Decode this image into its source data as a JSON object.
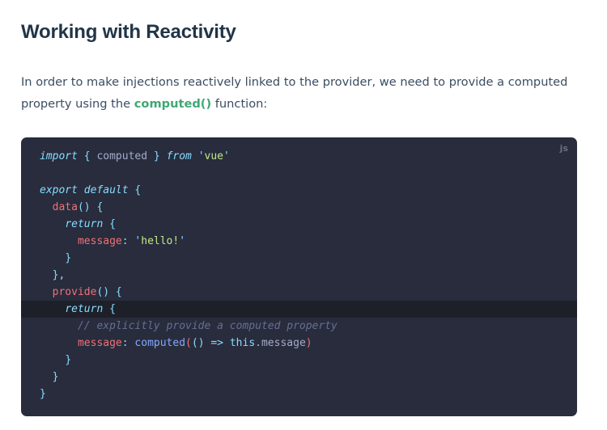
{
  "heading": "Working with Reactivity",
  "paragraph": {
    "before": "In order to make injections reactively linked to the provider, we need to provide a computed property using the ",
    "code_link": "computed()",
    "after": " function:"
  },
  "code_block": {
    "language": "js",
    "highlighted_line_index": 10,
    "lines": [
      {
        "tokens": [
          {
            "t": "kw",
            "v": "import"
          },
          {
            "t": "punc",
            "v": " { "
          },
          {
            "t": "ident",
            "v": "computed"
          },
          {
            "t": "punc",
            "v": " } "
          },
          {
            "t": "kw",
            "v": "from"
          },
          {
            "t": "plain",
            "v": " "
          },
          {
            "t": "punc",
            "v": "'"
          },
          {
            "t": "str",
            "v": "vue"
          },
          {
            "t": "punc",
            "v": "'"
          }
        ]
      },
      {
        "tokens": []
      },
      {
        "tokens": [
          {
            "t": "kw",
            "v": "export"
          },
          {
            "t": "plain",
            "v": " "
          },
          {
            "t": "kw",
            "v": "default"
          },
          {
            "t": "punc",
            "v": " {"
          }
        ]
      },
      {
        "tokens": [
          {
            "t": "plain",
            "v": "  "
          },
          {
            "t": "fn",
            "v": "data"
          },
          {
            "t": "punc",
            "v": "() {"
          }
        ]
      },
      {
        "tokens": [
          {
            "t": "plain",
            "v": "    "
          },
          {
            "t": "kw",
            "v": "return"
          },
          {
            "t": "punc",
            "v": " {"
          }
        ]
      },
      {
        "tokens": [
          {
            "t": "plain",
            "v": "      "
          },
          {
            "t": "prop",
            "v": "message"
          },
          {
            "t": "punc",
            "v": ": "
          },
          {
            "t": "punc",
            "v": "'"
          },
          {
            "t": "str",
            "v": "hello!"
          },
          {
            "t": "punc",
            "v": "'"
          }
        ]
      },
      {
        "tokens": [
          {
            "t": "plain",
            "v": "    "
          },
          {
            "t": "punc",
            "v": "}"
          }
        ]
      },
      {
        "tokens": [
          {
            "t": "plain",
            "v": "  "
          },
          {
            "t": "punc",
            "v": "},"
          }
        ]
      },
      {
        "tokens": [
          {
            "t": "plain",
            "v": "  "
          },
          {
            "t": "fn",
            "v": "provide"
          },
          {
            "t": "punc",
            "v": "() {"
          }
        ]
      },
      {
        "tokens": [
          {
            "t": "plain",
            "v": "    "
          },
          {
            "t": "kw",
            "v": "return"
          },
          {
            "t": "punc",
            "v": " {"
          }
        ]
      },
      {
        "tokens": [
          {
            "t": "plain",
            "v": "      "
          },
          {
            "t": "comment",
            "v": "// explicitly provide a computed property"
          }
        ]
      },
      {
        "tokens": [
          {
            "t": "plain",
            "v": "      "
          },
          {
            "t": "prop",
            "v": "message"
          },
          {
            "t": "punc",
            "v": ": "
          },
          {
            "t": "call",
            "v": "computed"
          },
          {
            "t": "paren",
            "v": "("
          },
          {
            "t": "punc",
            "v": "() => "
          },
          {
            "t": "this",
            "v": "this"
          },
          {
            "t": "plain",
            "v": ".message"
          },
          {
            "t": "paren",
            "v": ")"
          }
        ]
      },
      {
        "tokens": [
          {
            "t": "plain",
            "v": "    "
          },
          {
            "t": "punc",
            "v": "}"
          }
        ]
      },
      {
        "tokens": [
          {
            "t": "plain",
            "v": "  "
          },
          {
            "t": "punc",
            "v": "}"
          }
        ]
      },
      {
        "tokens": [
          {
            "t": "punc",
            "v": "}"
          }
        ]
      }
    ]
  }
}
